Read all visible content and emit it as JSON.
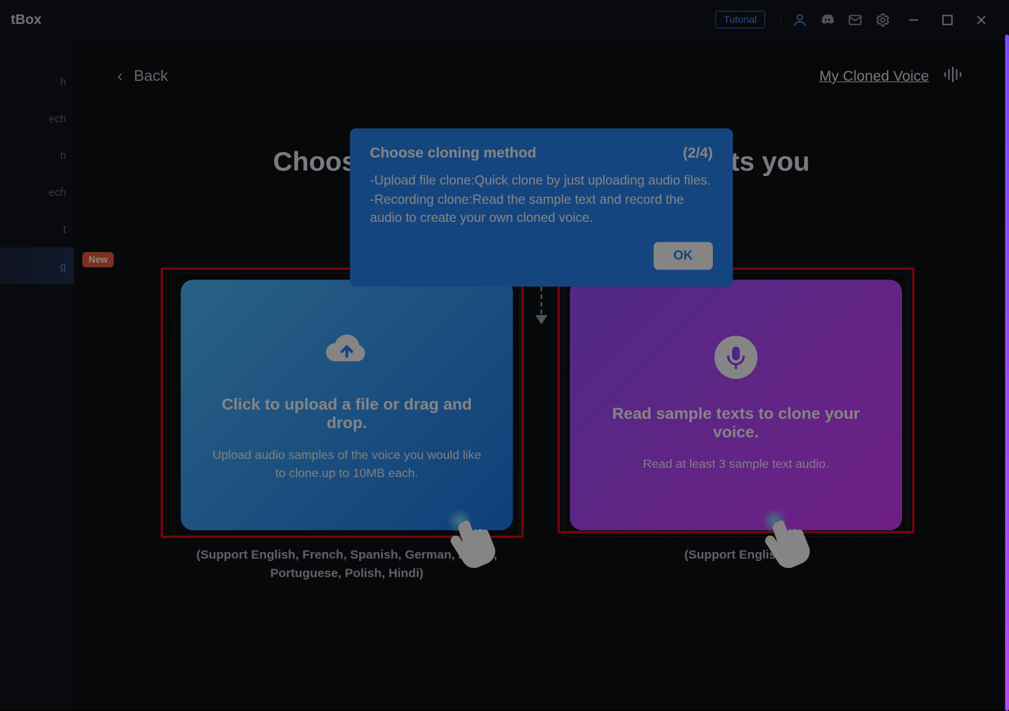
{
  "app_name": "tBox",
  "titlebar": {
    "tutorial_label": "Tutorial"
  },
  "sidebar": {
    "items": [
      {
        "label": "h"
      },
      {
        "label": "ech"
      },
      {
        "label": "h"
      },
      {
        "label": "ech"
      },
      {
        "label": "t"
      },
      {
        "label": "g",
        "active": true,
        "badge": "New"
      }
    ]
  },
  "subheader": {
    "back_label": "Back",
    "my_cloned_label": "My Cloned Voice"
  },
  "page_title": "Choose the cloning method that suits you",
  "cards": {
    "upload": {
      "title": "Click to upload a file or drag and drop.",
      "subtitle": "Upload audio samples of the voice you would like to clone.up to 10MB each.",
      "support": "(Support English, French, Spanish, German, Italian, Portuguese, Polish, Hindi)"
    },
    "record": {
      "title": "Read sample texts to clone your voice.",
      "subtitle": "Read at least 3 sample text audio.",
      "support": "(Support English)"
    }
  },
  "popover": {
    "title": "Choose cloning method",
    "step": "(2/4)",
    "line1": "-Upload file clone:Quick clone by just uploading audio files.",
    "line2": "-Recording clone:Read the sample text and record the audio to create your own cloned voice.",
    "ok_label": "OK"
  }
}
